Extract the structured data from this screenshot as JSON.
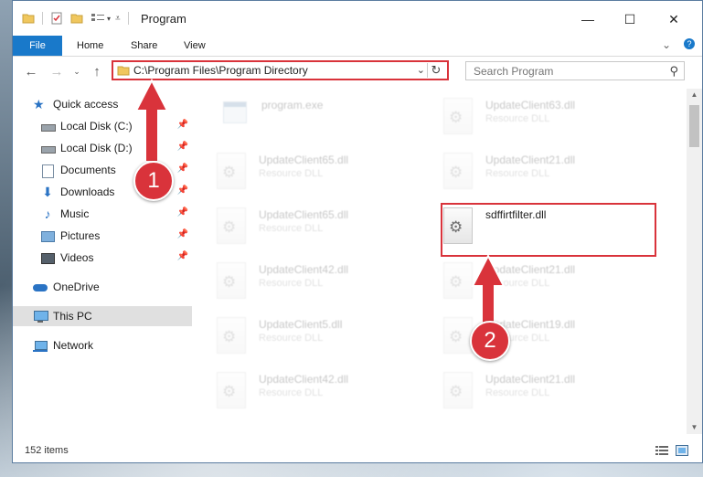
{
  "window": {
    "title": "Program",
    "controls": {
      "minimize": "—",
      "maximize": "☐",
      "close": "✕"
    }
  },
  "ribbon": {
    "tabs": [
      "File",
      "Home",
      "Share",
      "View"
    ]
  },
  "address": {
    "path": "C:\\Program Files\\Program Directory"
  },
  "search": {
    "placeholder": "Search Program"
  },
  "sidebar": {
    "items": [
      {
        "label": "Quick access",
        "icon": "star-icon",
        "pinned": false
      },
      {
        "label": "Local Disk (C:)",
        "icon": "drive-icon",
        "pinned": true
      },
      {
        "label": "Local Disk (D:)",
        "icon": "drive-icon",
        "pinned": true
      },
      {
        "label": "Documents",
        "icon": "documents-icon",
        "pinned": true
      },
      {
        "label": "Downloads",
        "icon": "download-icon",
        "pinned": true
      },
      {
        "label": "Music",
        "icon": "music-icon",
        "pinned": true
      },
      {
        "label": "Pictures",
        "icon": "pictures-icon",
        "pinned": true
      },
      {
        "label": "Videos",
        "icon": "videos-icon",
        "pinned": true
      },
      {
        "label": "OneDrive",
        "icon": "cloud-icon",
        "pinned": false
      },
      {
        "label": "This PC",
        "icon": "computer-icon",
        "pinned": false,
        "selected": true
      },
      {
        "label": "Network",
        "icon": "network-icon",
        "pinned": false
      }
    ]
  },
  "files": [
    {
      "name": "program.exe",
      "type": ""
    },
    {
      "name": "UpdateClient63.dll",
      "type": "Resource DLL"
    },
    {
      "name": "UpdateClient65.dll",
      "type": "Resource DLL"
    },
    {
      "name": "UpdateClient21.dll",
      "type": "Resource DLL"
    },
    {
      "name": "UpdateClient65.dll",
      "type": "Resource DLL"
    },
    {
      "name": "sdffirtfilter.dll",
      "type": ""
    },
    {
      "name": "UpdateClient42.dll",
      "type": "Resource DLL"
    },
    {
      "name": "UpdateClient21.dll",
      "type": "Resource DLL"
    },
    {
      "name": "UpdateClient5.dll",
      "type": "Resource DLL"
    },
    {
      "name": "UpdateClient19.dll",
      "type": "Resource DLL"
    },
    {
      "name": "UpdateClient42.dll",
      "type": "Resource DLL"
    },
    {
      "name": "UpdateClient21.dll",
      "type": "Resource DLL"
    }
  ],
  "status": {
    "item_count": "152 items"
  },
  "annotations": {
    "badge1": "1",
    "badge2": "2",
    "color": "#d9333b"
  }
}
